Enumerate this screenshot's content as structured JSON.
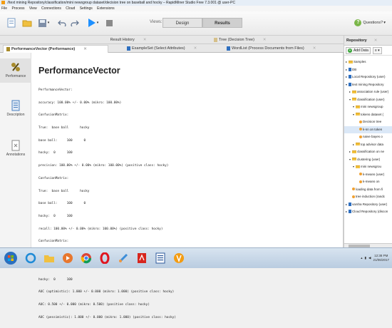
{
  "window": {
    "title": "//text mining Repository/classification/mini newsgroup dataset/decision tree on baseball and hocky – RapidMiner Studio Free 7.3.001 @ user-PC"
  },
  "menu": [
    "File",
    "Process",
    "View",
    "Connections",
    "Cloud",
    "Settings",
    "Extensions"
  ],
  "toolbar": {
    "views_label": "Views:",
    "design": "Design",
    "results": "Results",
    "questions": "Questions?"
  },
  "tabs": {
    "row1": [
      {
        "label": "Result History"
      },
      {
        "label": "Tree (Decision Tree)"
      }
    ],
    "row2": [
      {
        "label": "PerformanceVector (Performance)"
      },
      {
        "label": "ExampleSet (Select Attributes)"
      },
      {
        "label": "WordList (Process Documents from Files)"
      }
    ]
  },
  "leftnav": [
    "Performance",
    "Description",
    "Annotations"
  ],
  "performance": {
    "title": "PerformanceVector",
    "lines": [
      "PerformanceVector:",
      "accuracy: 100.00% +/- 0.00% (mikro: 100.00%)",
      "ConfusionMatrix:",
      "True:  base ball      hocky",
      "base ball:     100      0",
      "hocky:  0      100",
      "precision: 100.00% +/- 0.00% (mikro: 100.00%) (positive class: hocky)",
      "ConfusionMatrix:",
      "True:  base ball      hocky",
      "base ball:     100      0",
      "hocky:  0      100",
      "recall: 100.00% +/- 0.00% (mikro: 100.00%) (positive class: hocky)",
      "ConfusionMatrix:",
      "True:  base ball      hocky",
      "base ball:     100      0",
      "hocky:  0      100",
      "AUC (optimistic): 1.000 +/- 0.000 (mikro: 1.000) (positive class: hocky)",
      "AUC: 0.500 +/- 0.000 (mikro: 0.500) (positive class: hocky)",
      "AUC (pessimistic): 1.000 +/- 0.000 (mikro: 1.000) (positive class: hocky)"
    ]
  },
  "repository": {
    "title": "Repository",
    "add_data": "Add Data",
    "tree": [
      {
        "label": "Samples",
        "kind": "folder",
        "indent": 0
      },
      {
        "label": "DB",
        "kind": "db",
        "indent": 0
      },
      {
        "label": "Local Repository (user)",
        "kind": "db",
        "indent": 0
      },
      {
        "label": "text mining Repository",
        "kind": "db",
        "indent": 0,
        "open": true
      },
      {
        "label": "association rule (user)",
        "kind": "folder",
        "indent": 1
      },
      {
        "label": "classification (user)",
        "kind": "folder",
        "indent": 1,
        "open": true
      },
      {
        "label": "mini newsgroup",
        "kind": "folder",
        "indent": 2,
        "open": true
      },
      {
        "label": "tokens dataset (",
        "kind": "folder",
        "indent": 2,
        "open": true
      },
      {
        "label": "Decision tree",
        "kind": "leaf",
        "indent": 3
      },
      {
        "label": "k-nn on token",
        "kind": "leaf",
        "indent": 3,
        "selected": true
      },
      {
        "label": "naive bayes o",
        "kind": "leaf",
        "indent": 3
      },
      {
        "label": "top advisor data",
        "kind": "folder",
        "indent": 2
      },
      {
        "label": "classification on ne",
        "kind": "folder",
        "indent": 1
      },
      {
        "label": "clustering (user)",
        "kind": "folder",
        "indent": 1,
        "open": true
      },
      {
        "label": "mini newsgrou",
        "kind": "folder",
        "indent": 2,
        "open": true
      },
      {
        "label": "k-means (user)",
        "kind": "leaf",
        "indent": 3
      },
      {
        "label": "k-means on",
        "kind": "leaf",
        "indent": 3
      },
      {
        "label": "loading data from fi",
        "kind": "leaf",
        "indent": 1
      },
      {
        "label": "tree induction (randc",
        "kind": "leaf",
        "indent": 1
      },
      {
        "label": "varsha Repository (user)",
        "kind": "db",
        "indent": 0
      },
      {
        "label": "Cloud Repository (discon",
        "kind": "db",
        "indent": 0
      }
    ]
  },
  "taskbar": {
    "time": "12:38 PM",
    "date": "21/06/2017"
  },
  "colors": {
    "accent": "#2e6fc0",
    "folder": "#f0c040",
    "run": "#1e90ff"
  }
}
